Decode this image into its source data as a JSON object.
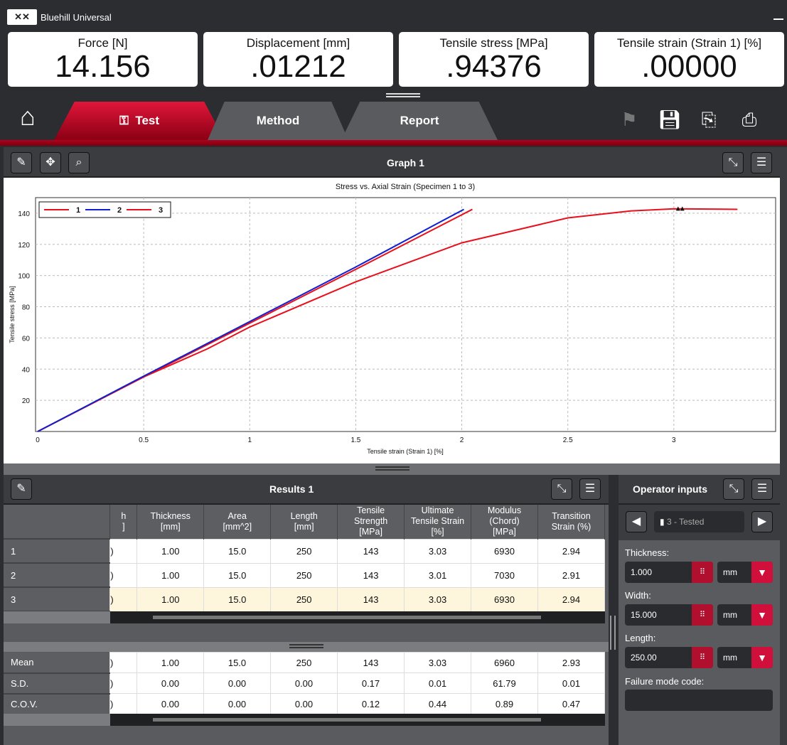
{
  "app": {
    "title": "Bluehill Universal",
    "logo_icon": "instron-logo"
  },
  "readouts": [
    {
      "label": "Force [N]",
      "value": "14.156"
    },
    {
      "label": "Displacement [mm]",
      "value": ".01212"
    },
    {
      "label": "Tensile stress [MPa]",
      "value": ".94376"
    },
    {
      "label": "Tensile strain (Strain 1) [%]",
      "value": ".00000"
    }
  ],
  "tabs": [
    {
      "label": "Test",
      "active": true
    },
    {
      "label": "Method"
    },
    {
      "label": "Report"
    }
  ],
  "toolbar_icons": [
    "home-icon",
    "finish-flag-icon",
    "save-icon",
    "export-icon",
    "print-icon"
  ],
  "graph": {
    "title": "Graph 1"
  },
  "chart_data": {
    "type": "line",
    "title": "Stress vs. Axial Strain (Specimen 1 to 3)",
    "xlabel": "Tensile strain (Strain 1) [%]",
    "ylabel": "Tensile stress [MPa]",
    "xlim": [
      0,
      3.48
    ],
    "ylim": [
      0,
      150
    ],
    "xticks": [
      "0",
      "0.5",
      "1",
      "1.5",
      "2",
      "2.5",
      "3"
    ],
    "yticks": [
      "20",
      "40",
      "60",
      "80",
      "100",
      "120",
      "140"
    ],
    "grid": true,
    "legend_placement": "top-left",
    "series": [
      {
        "name": "1",
        "color": "#e8101c",
        "x": [
          0,
          0.5,
          1,
          1.5,
          2.05
        ],
        "y": [
          0,
          35,
          69.5,
          104,
          142.5
        ]
      },
      {
        "name": "2",
        "color": "#1020d0",
        "x": [
          0,
          0.5,
          1,
          1.5,
          2.01
        ],
        "y": [
          0,
          35.5,
          70.5,
          105.5,
          142.5
        ]
      },
      {
        "name": "3",
        "color": "#e8101c",
        "x": [
          0,
          0.5,
          0.8,
          1,
          1.5,
          2,
          2.5,
          2.8,
          3,
          3.3
        ],
        "y": [
          0,
          35,
          53,
          67,
          96,
          121,
          137,
          141.5,
          142.8,
          142.5
        ]
      }
    ],
    "markers": [
      {
        "x": 3.02,
        "y": 143
      },
      {
        "x": 3.04,
        "y": 143
      }
    ]
  },
  "results": {
    "title": "Results 1",
    "headers": [
      "h\n]",
      "Thickness\n[mm]",
      "Area\n[mm^2]",
      "Length\n[mm]",
      "Tensile\nStrength\n[MPa]",
      "Ultimate\nTensile Strain\n[%]",
      "Modulus\n(Chord)\n[MPa]",
      "Transition\nStrain (%)"
    ],
    "rows": [
      {
        "label": "1",
        "cells": [
          ")",
          "1.00",
          "15.0",
          "250",
          "143",
          "3.03",
          "6930",
          "2.94"
        ]
      },
      {
        "label": "2",
        "cells": [
          ")",
          "1.00",
          "15.0",
          "250",
          "143",
          "3.01",
          "7030",
          "2.91"
        ]
      },
      {
        "label": "3",
        "cells": [
          ")",
          "1.00",
          "15.0",
          "250",
          "143",
          "3.03",
          "6930",
          "2.94"
        ],
        "selected": true
      }
    ],
    "stats": [
      {
        "label": "Mean",
        "cells": [
          ")",
          "1.00",
          "15.0",
          "250",
          "143",
          "3.03",
          "6960",
          "2.93"
        ]
      },
      {
        "label": "S.D.",
        "cells": [
          ")",
          "0.00",
          "0.00",
          "0.00",
          "0.17",
          "0.01",
          "61.79",
          "0.01"
        ]
      },
      {
        "label": "C.O.V.",
        "cells": [
          ")",
          "0.00",
          "0.00",
          "0.00",
          "0.12",
          "0.44",
          "0.89",
          "0.47"
        ]
      }
    ]
  },
  "operator": {
    "title": "Operator inputs",
    "specimen": "3 - Tested",
    "fields": [
      {
        "label": "Thickness:",
        "value": "1.000",
        "unit": "mm"
      },
      {
        "label": "Width:",
        "value": "15.000",
        "unit": "mm"
      },
      {
        "label": "Length:",
        "value": "250.00",
        "unit": "mm"
      }
    ],
    "failure_label": "Failure mode code:",
    "failure_value": ""
  }
}
